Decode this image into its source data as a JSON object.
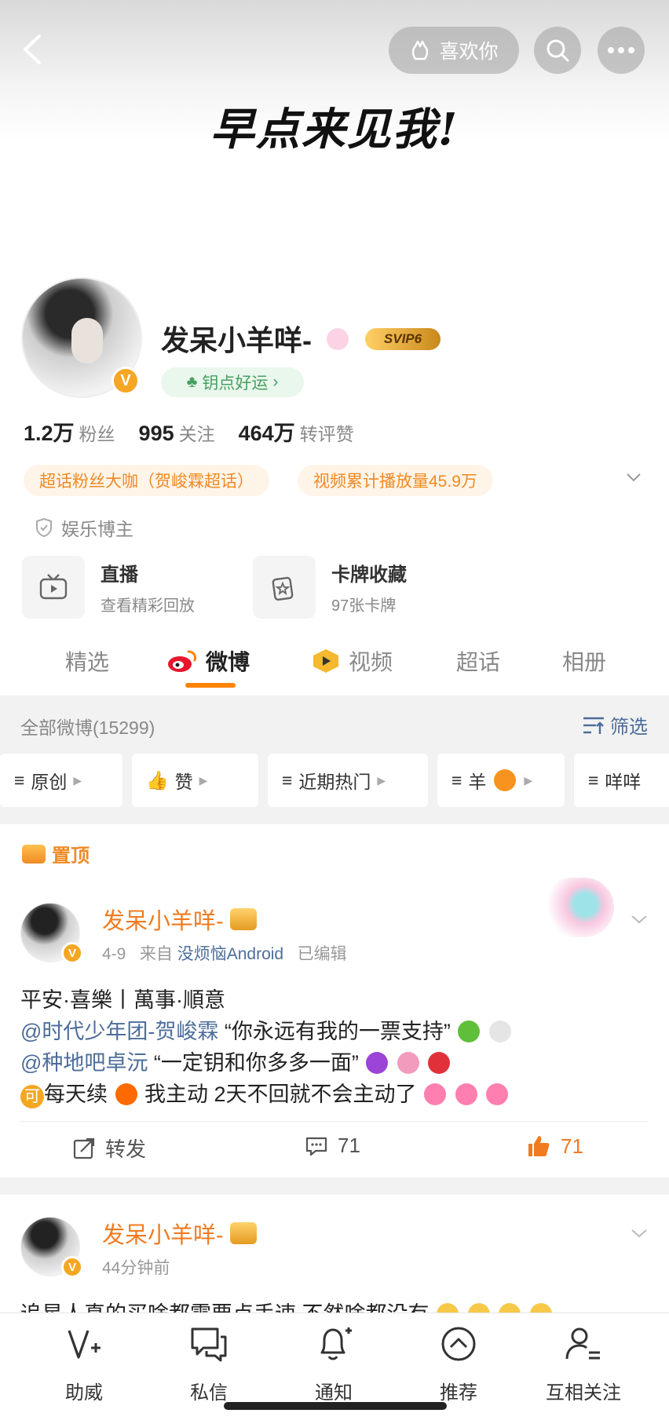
{
  "header": {
    "cover_text": "早点来见我!",
    "like_label": "喜欢你"
  },
  "profile": {
    "username": "发呆小羊咩-",
    "svip": "SVIP6",
    "luck_label": "钥点好运",
    "stats": [
      {
        "num": "1.2万",
        "label": "粉丝"
      },
      {
        "num": "995",
        "label": "关注"
      },
      {
        "num": "464万",
        "label": "转评赞"
      }
    ],
    "tags": [
      "超话粉丝大咖（贺峻霖超话）",
      "视频累计播放量45.9万"
    ],
    "entertainment": "娱乐博主",
    "cards": [
      {
        "title": "直播",
        "sub": "查看精彩回放"
      },
      {
        "title": "卡牌收藏",
        "sub": "97张卡牌"
      }
    ]
  },
  "tabs": [
    "精选",
    "微博",
    "视频",
    "超话",
    "相册"
  ],
  "feed": {
    "count_label": "全部微博(15299)",
    "filter_label": "筛选",
    "chips": [
      "原创",
      "赞",
      "近期热门",
      "羊",
      "咩咩"
    ]
  },
  "posts": [
    {
      "pinned_label": "置顶",
      "name": "发呆小羊咩-",
      "time": "4-9",
      "from": "来自",
      "source": "没烦恼Android",
      "edited": "已编辑",
      "line1": "平安·喜樂丨萬事·順意",
      "line2_at": "@时代少年团-贺峻霖",
      "line2_text": " “你永远有我的一票支持”",
      "line3_at": "@种地吧卓沅",
      "line3_text": " “一定钥和你多多一面”",
      "line4_badge": "可",
      "line4_a": "每天续",
      "line4_b": " 我主动 2天不回就不会主动了",
      "actions": {
        "repost": "转发",
        "comments": "71",
        "likes": "71"
      }
    },
    {
      "name": "发呆小羊咩-",
      "time": "44分钟前",
      "text": "追星人真的买啥都需要点手速 不然啥都没有"
    }
  ],
  "bottom_nav": [
    "助威",
    "私信",
    "通知",
    "推荐",
    "互相关注"
  ],
  "colors": {
    "accent": "#ff8200",
    "link": "#4d6d9a",
    "orange_text": "#f07b20"
  }
}
